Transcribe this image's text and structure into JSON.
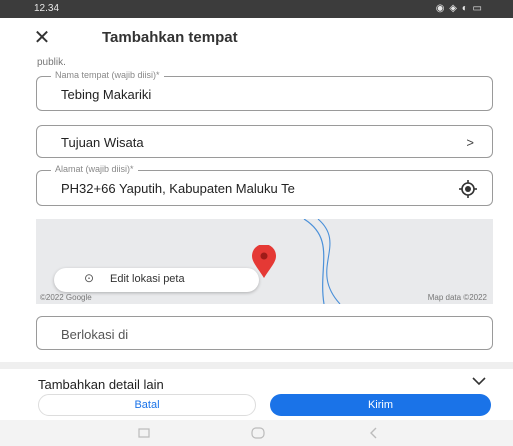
{
  "status_bar": {
    "time": "12.34",
    "icons_text": "◉ ◈ ◐ ▭"
  },
  "header": {
    "title": "Tambahkan tempat"
  },
  "intro": {
    "tail_text": "publik."
  },
  "form": {
    "name_field": {
      "label": "Nama tempat (wajib diisi)*",
      "value": "Tebing Makariki"
    },
    "category_field": {
      "value": "Tujuan Wisata",
      "chevron": ">"
    },
    "address_field": {
      "label": "Alamat (wajib diisi)*",
      "value": "PH32+66 Yaputih, Kabupaten Maluku Te"
    },
    "located_in_field": {
      "value": "Berlokasi di"
    }
  },
  "map": {
    "edit_label": "Edit lokasi peta",
    "google_credit": "©2022 Google",
    "map_data_credit": "Map data ©2022",
    "pin_color": "#e53935",
    "river_color": "#4a90d9"
  },
  "more_details": {
    "label": "Tambahkan detail lain"
  },
  "actions": {
    "cancel_label": "Batal",
    "send_label": "Kirim",
    "accent": "#1a73e8"
  }
}
